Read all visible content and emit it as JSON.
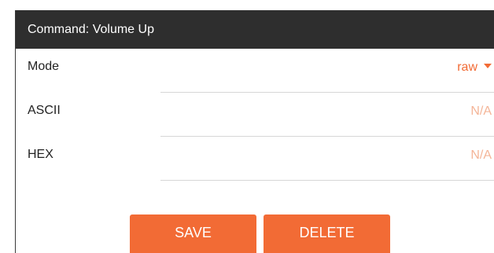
{
  "header": {
    "title": "Command: Volume Up"
  },
  "fields": {
    "mode": {
      "label": "Mode",
      "value": "raw"
    },
    "ascii": {
      "label": "ASCII",
      "value": "N/A"
    },
    "hex": {
      "label": "HEX",
      "value": "N/A"
    }
  },
  "actions": {
    "save_label": "SAVE",
    "delete_label": "DELETE"
  },
  "colors": {
    "header_bg": "#2e2e2e",
    "accent": "#f26b35",
    "muted_value": "#f4b598",
    "divider": "#d6d6d6"
  },
  "icons": {
    "mode_dropdown": "caret-down-icon"
  }
}
